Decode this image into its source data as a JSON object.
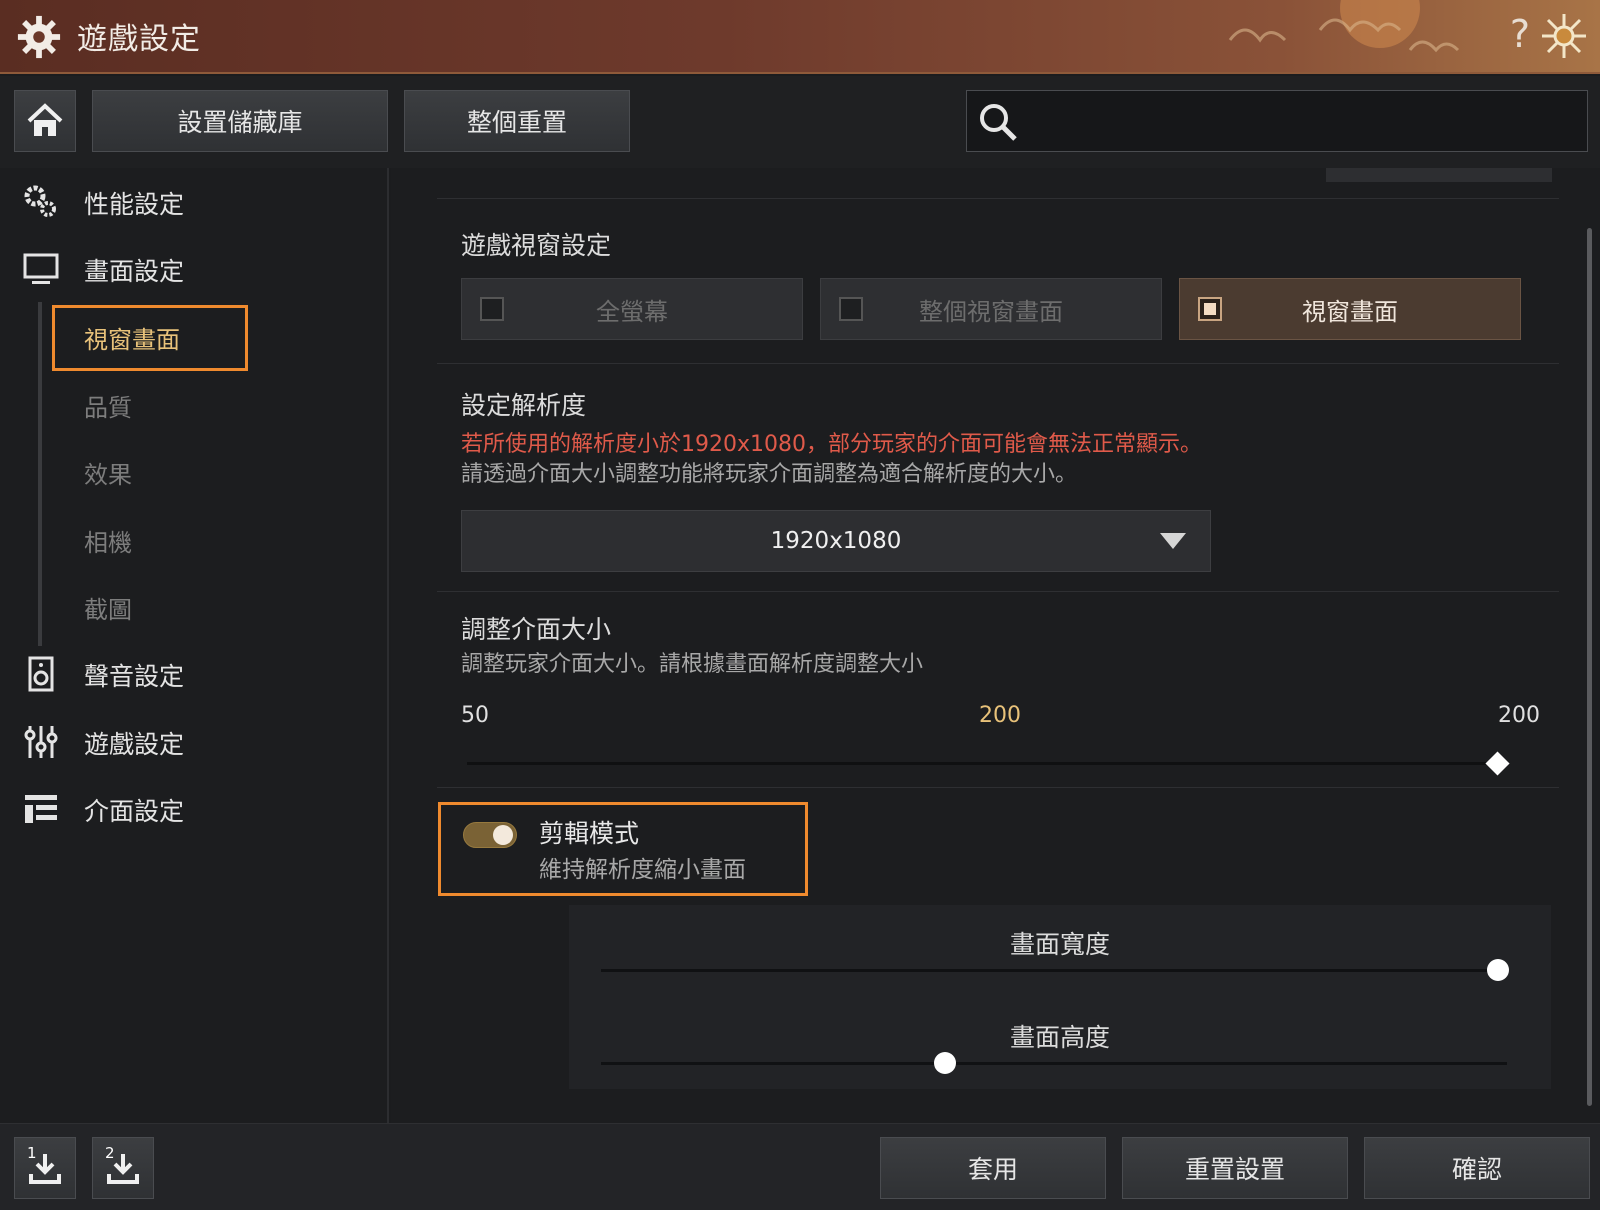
{
  "window": {
    "title": "遊戲設定",
    "help_glyph": "?"
  },
  "toolbar": {
    "storage_label": "設置儲藏庫",
    "reset_all_label": "整個重置",
    "search_placeholder": ""
  },
  "sidebar": {
    "items": [
      {
        "label": "性能設定",
        "icon": "performance-gears-icon"
      },
      {
        "label": "畫面設定",
        "icon": "monitor-icon"
      },
      {
        "label": "聲音設定",
        "icon": "speaker-icon"
      },
      {
        "label": "遊戲設定",
        "icon": "sliders-icon"
      },
      {
        "label": "介面設定",
        "icon": "layout-icon"
      }
    ],
    "sub_items": [
      {
        "label": "視窗畫面",
        "active": true
      },
      {
        "label": "品質",
        "active": false
      },
      {
        "label": "效果",
        "active": false
      },
      {
        "label": "相機",
        "active": false
      },
      {
        "label": "截圖",
        "active": false
      }
    ]
  },
  "window_mode": {
    "title": "遊戲視窗設定",
    "options": [
      {
        "label": "全螢幕",
        "checked": false
      },
      {
        "label": "整個視窗畫面",
        "checked": false
      },
      {
        "label": "視窗畫面",
        "checked": true
      }
    ]
  },
  "resolution": {
    "title": "設定解析度",
    "warning": "若所使用的解析度小於1920x1080，部分玩家的介面可能會無法正常顯示。",
    "hint": "請透過介面大小調整功能將玩家介面調整為適合解析度的大小。",
    "selected": "1920x1080"
  },
  "ui_scale": {
    "title": "調整介面大小",
    "hint": "調整玩家介面大小。請根據畫面解析度調整大小",
    "min": "50",
    "current": "200",
    "max": "200",
    "value_fraction": 1.0
  },
  "clip_mode": {
    "title": "剪輯模式",
    "subtitle": "維持解析度縮小畫面",
    "enabled": true,
    "width_label": "畫面寬度",
    "width_fraction": 0.99,
    "height_label": "畫面高度",
    "height_fraction": 0.38
  },
  "bottom": {
    "dl1_num": "1",
    "dl2_num": "2",
    "apply_label": "套用",
    "reset_label": "重置設置",
    "confirm_label": "確認"
  },
  "colors": {
    "accent": "#ef8a2e",
    "gold": "#e8c27a",
    "warning": "#e05a4a"
  }
}
